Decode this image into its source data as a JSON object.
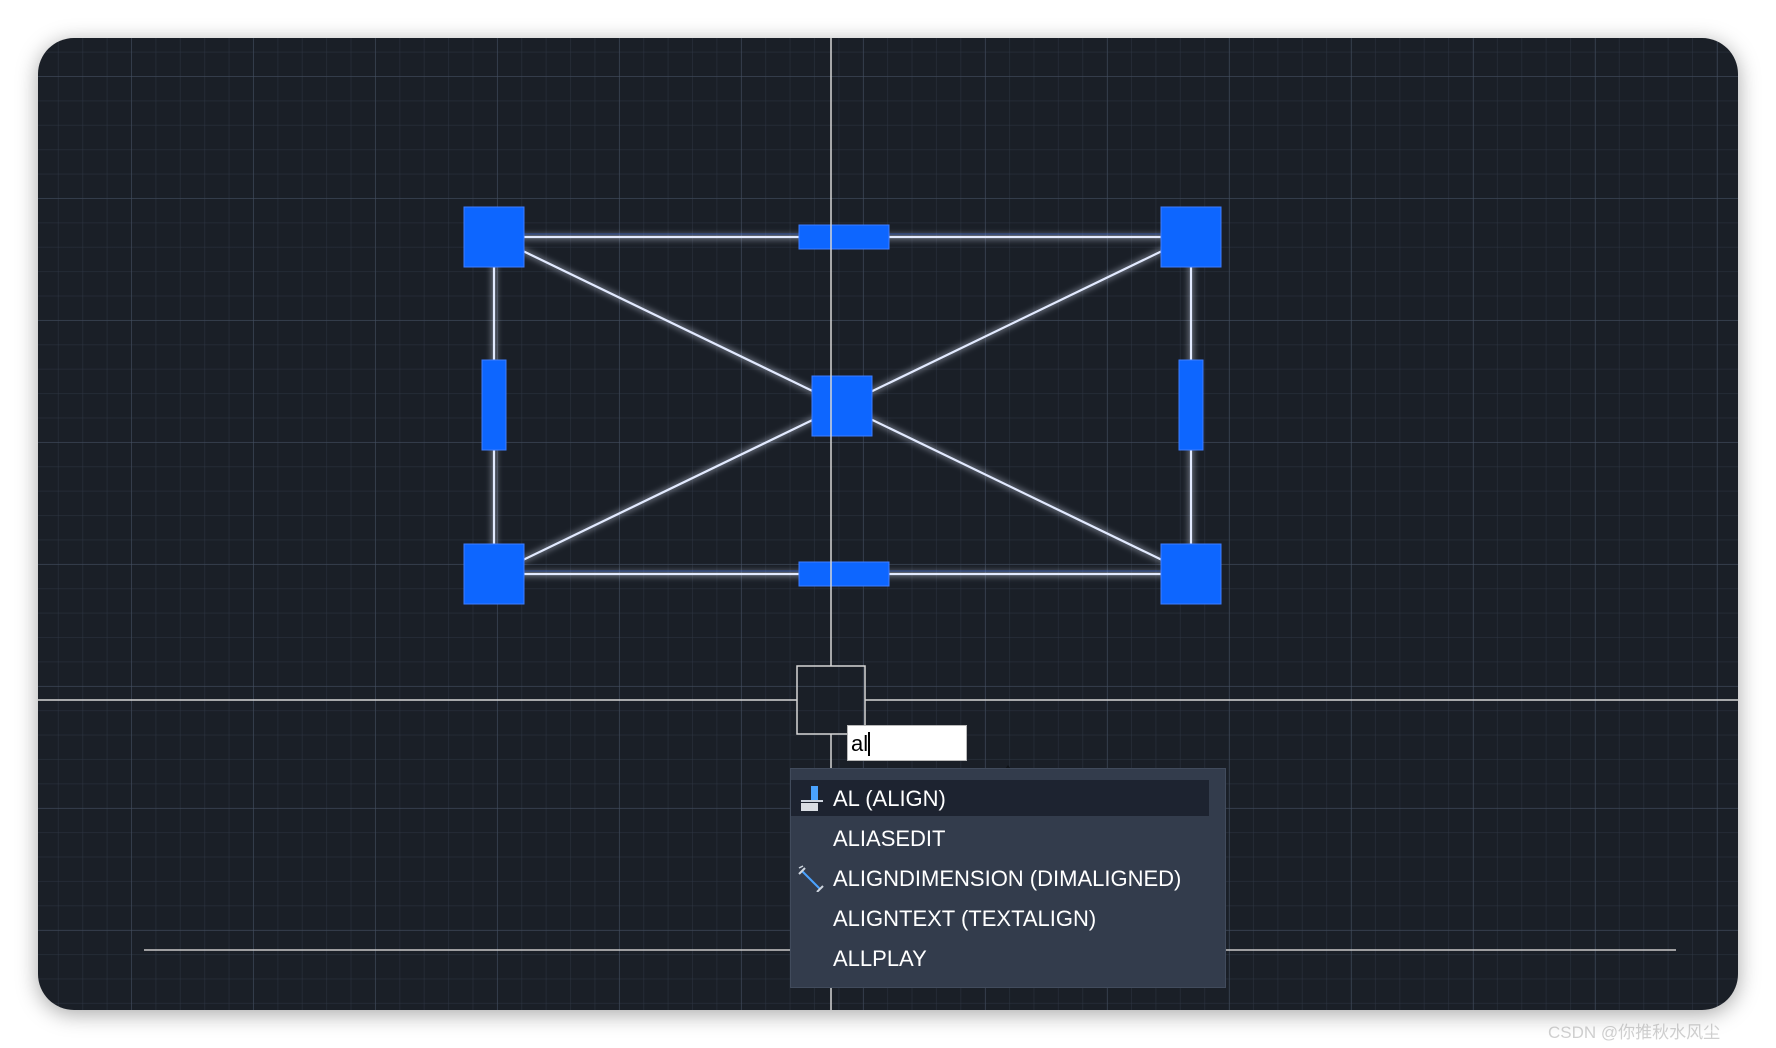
{
  "command_line": {
    "typed_text": "al"
  },
  "autocomplete": {
    "items": [
      {
        "label": "AL (ALIGN)",
        "icon": "align-icon",
        "selected": true
      },
      {
        "label": "ALIASEDIT",
        "icon": "",
        "selected": false
      },
      {
        "label": "ALIGNDIMENSION (DIMALIGNED)",
        "icon": "aligned-dimension-icon",
        "selected": false
      },
      {
        "label": "ALIGNTEXT (TEXTALIGN)",
        "icon": "",
        "selected": false
      },
      {
        "label": "ALLPLAY",
        "icon": "",
        "selected": false
      }
    ]
  },
  "canvas": {
    "background_color": "#1a1f27",
    "grip_color": "#0d66ff",
    "selected_line_color": "#dfe8ff",
    "crosshair_color": "#d6d6d6"
  },
  "watermark": {
    "text": "CSDN @你推秋水风尘"
  }
}
